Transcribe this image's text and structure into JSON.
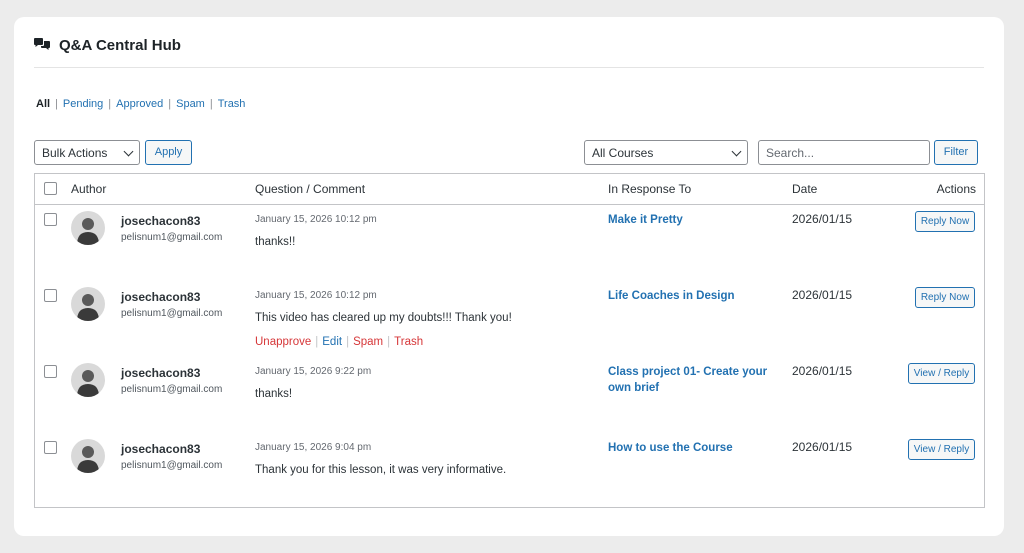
{
  "header": {
    "title": "Q&A Central Hub",
    "icon": "chat-bubbles-icon"
  },
  "filters": {
    "all": "All",
    "pending": "Pending",
    "approved": "Approved",
    "spam": "Spam",
    "trash": "Trash"
  },
  "toolbar": {
    "bulk_actions": "Bulk Actions",
    "apply": "Apply",
    "courses": "All Courses",
    "search_placeholder": "Search...",
    "filter": "Filter"
  },
  "table": {
    "headers": {
      "author": "Author",
      "question": "Question / Comment",
      "response": "In Response To",
      "date": "Date",
      "actions": "Actions"
    },
    "rows": [
      {
        "author": "josechacon83",
        "email": "pelisnum1@gmail.com",
        "posted": "January 15, 2026 10:12 pm",
        "comment": "thanks!!",
        "response": "Make it Pretty",
        "date": "2026/01/15",
        "action": "Reply Now"
      },
      {
        "author": "josechacon83",
        "email": "pelisnum1@gmail.com",
        "posted": "January 15, 2026 10:12 pm",
        "comment": "This video has cleared up my doubts!!! Thank you!",
        "response": "Life Coaches in Design",
        "date": "2026/01/15",
        "action": "Reply Now",
        "row_actions": {
          "unapprove": "Unapprove",
          "edit": "Edit",
          "spam": "Spam",
          "trash": "Trash"
        }
      },
      {
        "author": "josechacon83",
        "email": "pelisnum1@gmail.com",
        "posted": "January 15, 2026 9:22 pm",
        "comment": "thanks!",
        "response": "Class project 01- Create your own brief",
        "date": "2026/01/15",
        "action": "View / Reply"
      },
      {
        "author": "josechacon83",
        "email": "pelisnum1@gmail.com",
        "posted": "January 15, 2026 9:04 pm",
        "comment": "Thank you for this lesson, it was very informative.",
        "response": "How to use the Course",
        "date": "2026/01/15",
        "action": "View / Reply"
      }
    ]
  },
  "colors": {
    "link": "#2271b1",
    "danger": "#d63638",
    "background": "#ececec"
  }
}
